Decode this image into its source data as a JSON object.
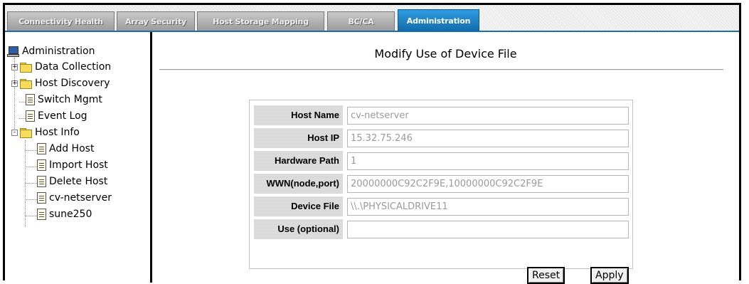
{
  "tabs": [
    {
      "label": "Connectivity Health",
      "active": false
    },
    {
      "label": "Array Security",
      "active": false
    },
    {
      "label": "Host Storage Mapping",
      "active": false
    },
    {
      "label": "BC/CA",
      "active": false
    },
    {
      "label": "Administration",
      "active": true
    }
  ],
  "sidebar": {
    "root_label": "Administration",
    "items": [
      {
        "label": "Data Collection",
        "type": "folder",
        "expander": "+"
      },
      {
        "label": "Host Discovery",
        "type": "folder",
        "expander": "+"
      },
      {
        "label": "Switch Mgmt",
        "type": "document"
      },
      {
        "label": "Event Log",
        "type": "document"
      },
      {
        "label": "Host Info",
        "type": "open-folder",
        "expander": "-"
      },
      {
        "label": "Add Host",
        "type": "document"
      },
      {
        "label": "Import Host",
        "type": "document"
      },
      {
        "label": "Delete Host",
        "type": "document"
      },
      {
        "label": "cv-netserver",
        "type": "document"
      },
      {
        "label": "sune250",
        "type": "document"
      }
    ]
  },
  "main": {
    "title": "Modify Use of Device File",
    "fields": [
      {
        "label": "Host Name",
        "value": "cv-netserver"
      },
      {
        "label": "Host IP",
        "value": "15.32.75.246"
      },
      {
        "label": "Hardware Path",
        "value": "1"
      },
      {
        "label": "WWN(node,port)",
        "value": "20000000C92C2F9E,10000000C92C2F9E"
      },
      {
        "label": "Device File",
        "value": "\\\\.\\PHYSICALDRIVE11"
      },
      {
        "label": "Use (optional)",
        "value": ""
      }
    ],
    "reset_label": "Reset",
    "apply_label": "Apply"
  }
}
